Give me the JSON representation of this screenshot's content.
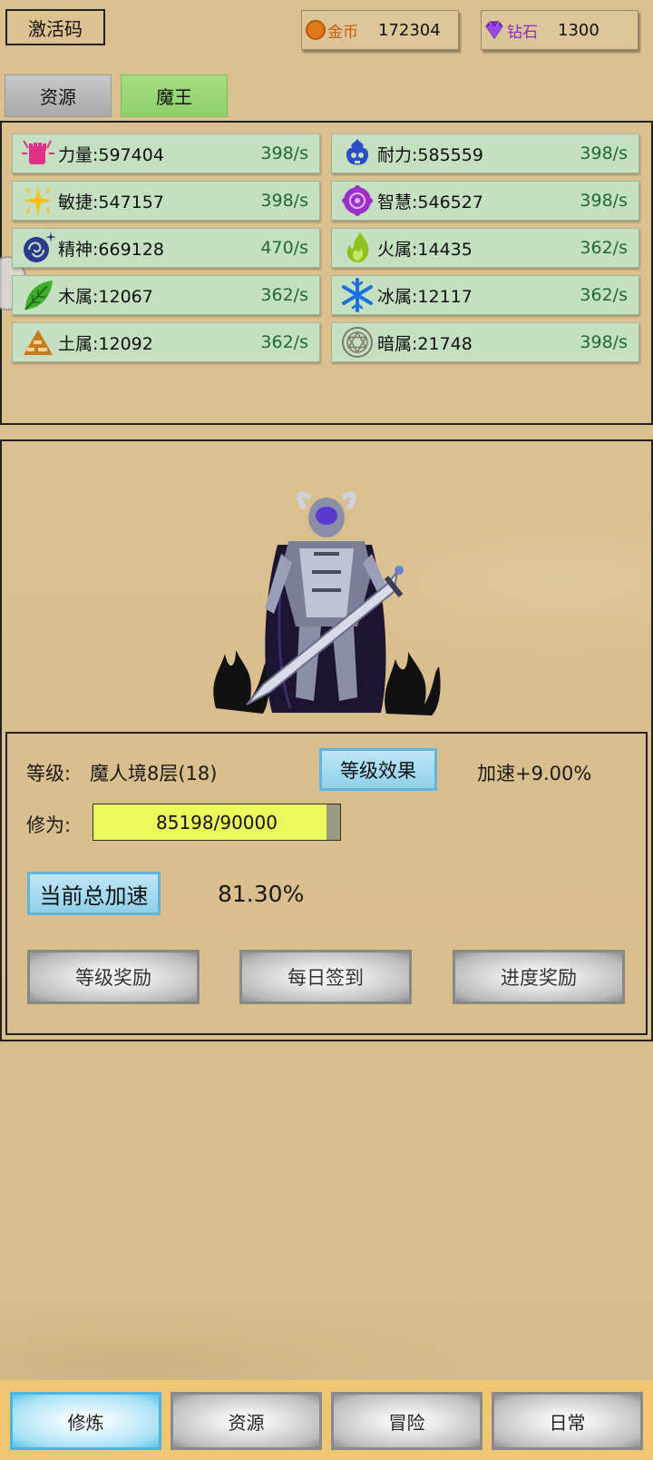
{
  "topbar": {
    "activation_code": "激活码",
    "gold": {
      "name": "金币",
      "value": "172304",
      "icon": "coin-icon",
      "color": "#e07a18"
    },
    "diamond": {
      "name": "钻石",
      "value": "1300",
      "icon": "diamond-icon",
      "color": "#8a2cc8"
    }
  },
  "tabs": [
    {
      "label": "资源",
      "active": false
    },
    {
      "label": "魔王",
      "active": true
    }
  ],
  "stats": [
    {
      "label": "力量:597404",
      "rate": "398/s",
      "icon": "fist-icon",
      "color": "#e0308a"
    },
    {
      "label": "耐力:585559",
      "rate": "398/s",
      "icon": "skull-icon",
      "color": "#2b4bc8"
    },
    {
      "label": "敏捷:547157",
      "rate": "398/s",
      "icon": "sparkle-icon",
      "color": "#f2c21a"
    },
    {
      "label": "智慧:546527",
      "rate": "398/s",
      "icon": "wisdom-icon",
      "color": "#9b2fc9"
    },
    {
      "label": "精神:669128",
      "rate": "470/s",
      "icon": "spirit-icon",
      "color": "#2a3a8c"
    },
    {
      "label": "火属:14435",
      "rate": "362/s",
      "icon": "fire-icon",
      "color": "#8fc21d"
    },
    {
      "label": "木属:12067",
      "rate": "362/s",
      "icon": "leaf-icon",
      "color": "#3fae2a"
    },
    {
      "label": "冰属:12117",
      "rate": "362/s",
      "icon": "snowflake-icon",
      "color": "#1c6fe0"
    },
    {
      "label": "土属:12092",
      "rate": "362/s",
      "icon": "earth-icon",
      "color": "#c77a1e"
    },
    {
      "label": "暗属:21748",
      "rate": "398/s",
      "icon": "dark-icon",
      "color": "#7a7a6a"
    }
  ],
  "character": {
    "level_label": "等级:",
    "level_value": "魔人境8层(18)",
    "level_effect_button": "等级效果",
    "speed_bonus": "加速+9.00%",
    "cultivation_label": "修为:",
    "cultivation_progress": "85198/90000",
    "cultivation_fraction": 0.9466,
    "total_speed_button": "当前总加速",
    "total_speed_value": "81.30%",
    "buttons": [
      "等级奖励",
      "每日签到",
      "进度奖励"
    ]
  },
  "nav": [
    {
      "label": "修炼",
      "active": true
    },
    {
      "label": "资源",
      "active": false
    },
    {
      "label": "冒险",
      "active": false
    },
    {
      "label": "日常",
      "active": false
    }
  ]
}
